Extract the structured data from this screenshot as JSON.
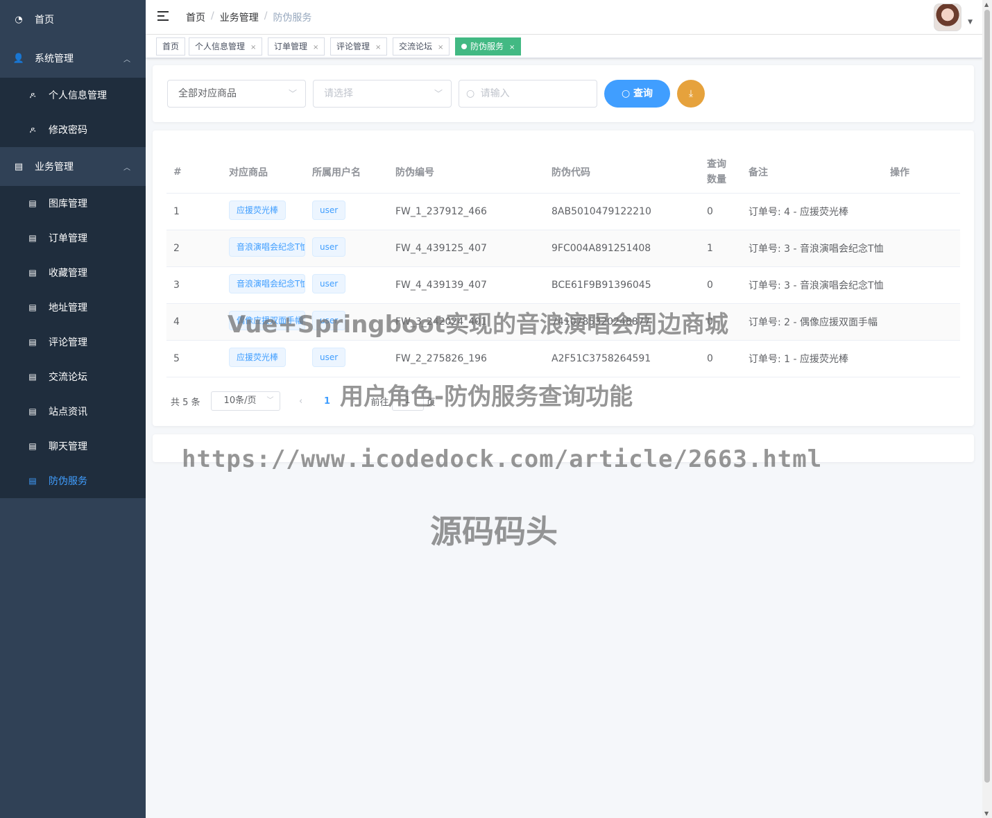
{
  "sidebar": {
    "home": "首页",
    "system": {
      "label": "系统管理",
      "items": [
        "个人信息管理",
        "修改密码"
      ]
    },
    "business": {
      "label": "业务管理",
      "items": [
        "图库管理",
        "订单管理",
        "收藏管理",
        "地址管理",
        "评论管理",
        "交流论坛",
        "站点资讯",
        "聊天管理",
        "防伪服务"
      ]
    },
    "active_item": "防伪服务"
  },
  "breadcrumb": [
    "首页",
    "业务管理",
    "防伪服务"
  ],
  "tags": [
    {
      "label": "首页",
      "closable": false,
      "active": false
    },
    {
      "label": "个人信息管理",
      "closable": true,
      "active": false
    },
    {
      "label": "订单管理",
      "closable": true,
      "active": false
    },
    {
      "label": "评论管理",
      "closable": true,
      "active": false
    },
    {
      "label": "交流论坛",
      "closable": true,
      "active": false
    },
    {
      "label": "防伪服务",
      "closable": true,
      "active": true
    }
  ],
  "filters": {
    "product_select_value": "全部对应商品",
    "select_placeholder": "请选择",
    "search_placeholder": "请输入",
    "query_button": "查询"
  },
  "table": {
    "headers": [
      "#",
      "对应商品",
      "所属用户名",
      "防伪编号",
      "防伪代码",
      "查询数量",
      "备注",
      "操作"
    ],
    "rows": [
      [
        "1",
        "应援荧光棒",
        "user",
        "FW_1_237912_466",
        "8AB5010479122210",
        "0",
        "订单号: 4 - 应援荧光棒"
      ],
      [
        "2",
        "音浪演唱会纪念T恤",
        "user",
        "FW_4_439125_407",
        "9FC004A891251408",
        "1",
        "订单号: 3 - 音浪演唱会纪念T恤"
      ],
      [
        "3",
        "音浪演唱会纪念T恤",
        "user",
        "FW_4_439139_407",
        "BCE61F9B91396045",
        "0",
        "订单号: 3 - 音浪演唱会纪念T恤"
      ],
      [
        "4",
        "偶像应援双面手幅",
        "user",
        "FW_3_242024_401",
        "7410785320248877",
        "0",
        "订单号: 2 - 偶像应援双面手幅"
      ],
      [
        "5",
        "应援荧光棒",
        "user",
        "FW_2_275826_196",
        "A2F51C3758264591",
        "0",
        "订单号: 1 - 应援荧光棒"
      ]
    ]
  },
  "pagination": {
    "total": "共 5 条",
    "page_size": "10条/页",
    "current": "1",
    "goto_prefix": "前往",
    "goto_value": "1",
    "goto_suffix": "页"
  },
  "watermarks": {
    "line1": "Vue+Springboot实现的音浪演唱会周边商城",
    "line2": "用户角色-防伪服务查询功能",
    "line3": "https://www.icodedock.com/article/2663.html",
    "line4": "源码码头"
  },
  "colors": {
    "sidebar_bg": "#304156",
    "submenu_bg": "#1f2d3d",
    "primary": "#409eff",
    "tag_active": "#42b983",
    "download": "#e6a23c"
  }
}
